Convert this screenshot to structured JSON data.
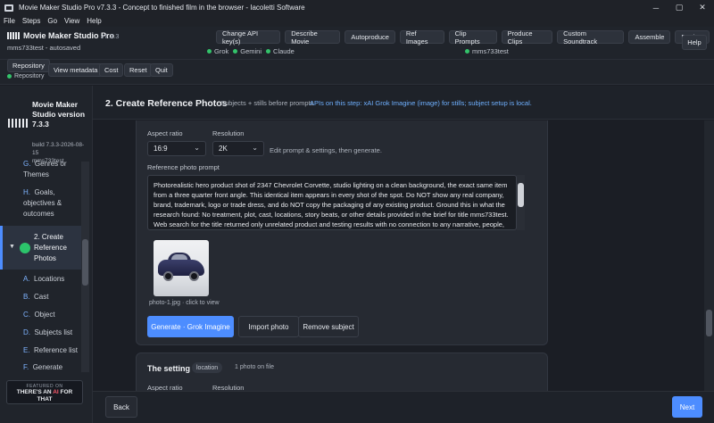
{
  "window": {
    "title": "Movie Maker Studio Pro v7.3.3 - Concept to finished film in the browser - Iacoletti Software",
    "controls": [
      "─",
      "▢",
      "✕"
    ]
  },
  "menu": [
    "File",
    "Steps",
    "Go",
    "View",
    "Help"
  ],
  "header": {
    "brand": "Movie Maker Studio Pro",
    "version": "v7.3.3",
    "autosaved": "mms733test - autosaved",
    "nav": [
      "Change API key(s)",
      "Describe Movie",
      "Autoproduce",
      "Ref Images",
      "Clip Prompts",
      "Produce Clips",
      "Custom Soundtrack",
      "Assemble",
      "Review"
    ],
    "help": "Help",
    "providers": [
      "Grok",
      "Gemini",
      "Claude"
    ],
    "project_status": "mms733test"
  },
  "toolbar": {
    "repository": "Repository",
    "view_metadata": "View metadata",
    "cost": "Cost",
    "reset": "Reset",
    "quit": "Quit",
    "repo_status": "Repository"
  },
  "sidebar": {
    "title": "Movie Maker Studio version 7.3.3",
    "build": "build 7.3.3-2026-08-15",
    "project": "mms733test",
    "items": [
      {
        "letter": "G.",
        "label": "Genres or Themes"
      },
      {
        "letter": "H.",
        "label": "Goals, objectives & outcomes"
      },
      {
        "letter": "2.",
        "label": "Create Reference Photos"
      },
      {
        "letter": "A.",
        "label": "Locations"
      },
      {
        "letter": "B.",
        "label": "Cast"
      },
      {
        "letter": "C.",
        "label": "Object"
      },
      {
        "letter": "D.",
        "label": "Subjects list"
      },
      {
        "letter": "E.",
        "label": "Reference list"
      },
      {
        "letter": "F.",
        "label": "Generate"
      }
    ],
    "featured": {
      "line1": "FEATURED ON",
      "line2a": "THERE'S AN",
      "ai": "AI",
      "line2b": "FOR",
      "line3": "THAT"
    }
  },
  "main": {
    "title": "2. Create Reference Photos",
    "subtitle": "Subjects + stills before prompts",
    "api_note": "APIs on this step: xAI Grok Imagine (image) for stills; subject setup is local.",
    "aspect_label": "Aspect ratio",
    "aspect_value": "16:9",
    "resolution_label": "Resolution",
    "resolution_value": "2K",
    "edit_hint": "Edit prompt & settings, then generate.",
    "prompt_label": "Reference photo prompt",
    "prompt_text": "Photorealistic hero product shot of 2347 Chevrolet Corvette, studio lighting on a clean background, the exact same item from a three quarter front angle. This identical item appears in every shot of the spot. Do NOT show any real company, brand, trademark, logo or trade dress, and do NOT copy the packaging of any existing product. Ground this in what the research found: No treatment, plot, cast, locations, story beats, or other details provided in the brief for title mms733test. Web search for the title returned only unrelated product and testing results with no connection to any narrative, people, places, or subjects. No usable real persons, locations, or recurring elements found.",
    "photo_caption": "photo-1.jpg · click to view",
    "generate": "Generate · Grok Imagine",
    "import": "Import photo",
    "remove": "Remove subject",
    "setting_title": "The setting",
    "setting_pill": "location",
    "setting_count": "1 photo on file",
    "peek_aspect": "Aspect ratio",
    "peek_resolution": "Resolution"
  },
  "footer": {
    "back": "Back",
    "next": "Next"
  }
}
